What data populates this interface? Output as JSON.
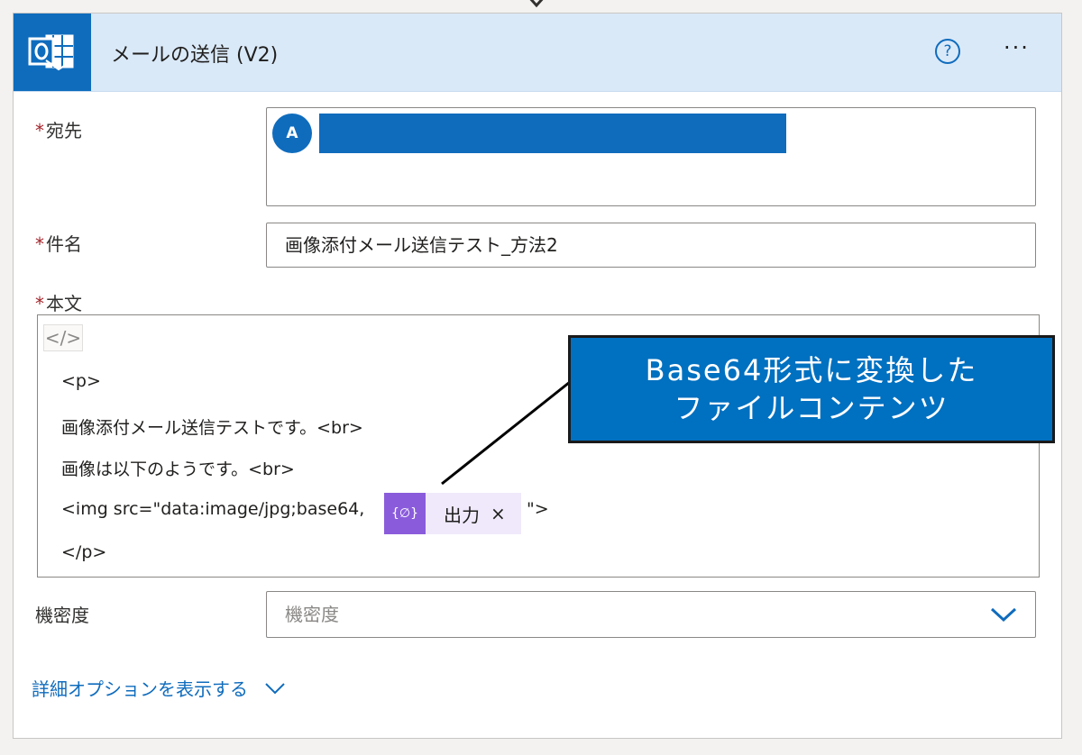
{
  "action": {
    "title": "メールの送信 (V2)",
    "help_glyph": "?",
    "more_glyph": "···"
  },
  "fields": {
    "to": {
      "label": "宛先",
      "required_mark": "*",
      "avatar_initial": "A"
    },
    "subject": {
      "label": "件名",
      "required_mark": "*",
      "value": "画像添付メール送信テスト_方法2"
    },
    "body": {
      "label": "本文",
      "required_mark": "*",
      "code_view_glyph": "</>",
      "lines": {
        "l1": "<p>",
        "l2": "画像添付メール送信テストです。<br>",
        "l3": "画像は以下のようです。<br>",
        "l4_prefix": "<img src=\"data:image/jpg;base64,",
        "l4_suffix": "\">",
        "l5": "</p>"
      },
      "token": {
        "label": "出力",
        "close_glyph": "×",
        "icon_glyph": "{∅}"
      }
    },
    "confidentiality": {
      "label": "機密度",
      "placeholder": "機密度"
    }
  },
  "advanced_options_link": "詳細オプションを表示する",
  "callout": {
    "line1": "Base64形式に変換した",
    "line2": "ファイルコンテンツ"
  },
  "colors": {
    "brand": "#0f6cbd",
    "header_bg": "#dae9f8",
    "token_bg": "#f0e9fb",
    "token_icon": "#8a5cdb",
    "callout_bg": "#0070c0",
    "required": "#a4262c"
  }
}
